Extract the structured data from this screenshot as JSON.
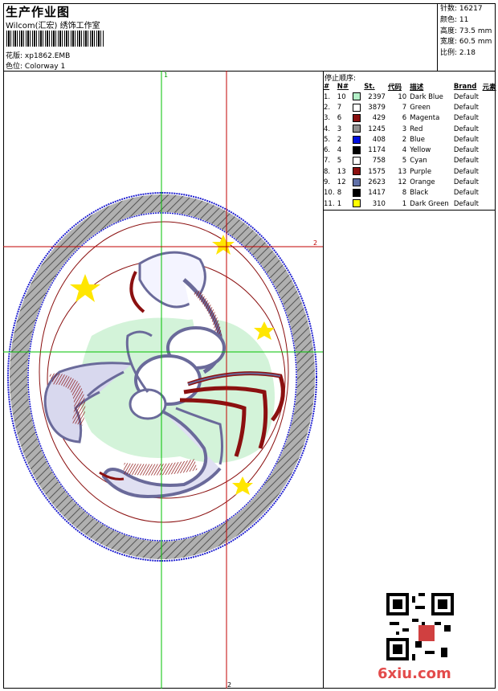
{
  "header": {
    "title": "生产作业图",
    "subtitle": "Wilcom(汇宏) 绣饰工作室",
    "design_label": "花版:",
    "design_value": "xp1862.EMB",
    "colorway_label": "色位:",
    "colorway_value": "Colorway 1"
  },
  "stats": [
    {
      "label": "针数:",
      "value": "16217"
    },
    {
      "label": "颜色:",
      "value": "11"
    },
    {
      "label": "高度:",
      "value": "73.5 mm"
    },
    {
      "label": "宽度:",
      "value": "60.5 mm"
    },
    {
      "label": "比例:",
      "value": "2.18"
    }
  ],
  "stop_sequence": {
    "title": "停止顺序:",
    "columns": [
      "#",
      "N#",
      "St.",
      "代码",
      "描述",
      "Brand",
      "元素"
    ],
    "rows": [
      {
        "idx": "1.",
        "n": "10",
        "color": "#b4f0c8",
        "st": "2397",
        "code": "10",
        "desc": "Dark Blue",
        "brand": "Default"
      },
      {
        "idx": "2.",
        "n": "7",
        "color": "#ffffff",
        "st": "3879",
        "code": "7",
        "desc": "Green",
        "brand": "Default"
      },
      {
        "idx": "3.",
        "n": "6",
        "color": "#8b1010",
        "st": "429",
        "code": "6",
        "desc": "Magenta",
        "brand": "Default"
      },
      {
        "idx": "4.",
        "n": "3",
        "color": "#909090",
        "st": "1245",
        "code": "3",
        "desc": "Red",
        "brand": "Default"
      },
      {
        "idx": "5.",
        "n": "2",
        "color": "#0010e0",
        "st": "408",
        "code": "2",
        "desc": "Blue",
        "brand": "Default"
      },
      {
        "idx": "6.",
        "n": "4",
        "color": "#000000",
        "st": "1174",
        "code": "4",
        "desc": "Yellow",
        "brand": "Default"
      },
      {
        "idx": "7.",
        "n": "5",
        "color": "#ffffff",
        "st": "758",
        "code": "5",
        "desc": "Cyan",
        "brand": "Default"
      },
      {
        "idx": "8.",
        "n": "13",
        "color": "#8b1010",
        "st": "1575",
        "code": "13",
        "desc": "Purple",
        "brand": "Default"
      },
      {
        "idx": "9.",
        "n": "12",
        "color": "#6070a8",
        "st": "2623",
        "code": "12",
        "desc": "Orange",
        "brand": "Default"
      },
      {
        "idx": "10.",
        "n": "8",
        "color": "#000000",
        "st": "1417",
        "code": "8",
        "desc": "Black",
        "brand": "Default"
      },
      {
        "idx": "11.",
        "n": "1",
        "color": "#ffff00",
        "st": "310",
        "code": "1",
        "desc": "Dark Green",
        "brand": "Default"
      }
    ]
  },
  "guides": {
    "v1": "1",
    "v2": "2",
    "h2": "2"
  },
  "colors": {
    "guide_green": "#00c000",
    "guide_red": "#c00000",
    "ring_blue": "#2020d0",
    "ring_gray": "#a8a8a8",
    "scorpion": "#6a6a9a",
    "accent_red": "#8b1010",
    "star": "#ffe600",
    "leaf": "#c8f0d0"
  },
  "watermark": "6xiu.com"
}
